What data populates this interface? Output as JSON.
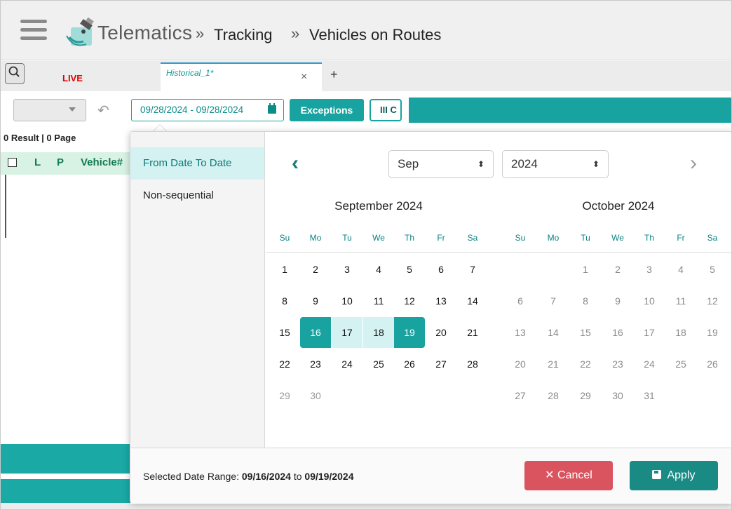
{
  "header": {
    "brand": "Telematics",
    "crumbs": [
      "Tracking",
      "Vehicles on Routes"
    ],
    "separator": "»"
  },
  "tabs": {
    "live": "LIVE",
    "historical": "Historical_1*",
    "close": "×",
    "add": "+"
  },
  "toolbar": {
    "date_range": "09/28/2024 - 09/28/2024",
    "exceptions": "Exceptions",
    "columns": "III C",
    "undo": "↶"
  },
  "results": "0 Result | 0 Page",
  "grid": {
    "cols": [
      "L",
      "P",
      "Vehicle#"
    ]
  },
  "picker": {
    "options": [
      "From Date To Date",
      "Non-sequential"
    ],
    "month_select": "Sep",
    "year_select": "2024",
    "prev": "‹",
    "next": "›",
    "updown": "⬍",
    "left_title": "September 2024",
    "right_title": "October 2024",
    "weekdays": [
      "Su",
      "Mo",
      "Tu",
      "We",
      "Th",
      "Fr",
      "Sa"
    ],
    "footer_label": "Selected Date Range:",
    "range_from": "09/16/2024",
    "range_to": "09/19/2024",
    "range_join": "to",
    "cancel": "✕  Cancel",
    "apply": "Apply"
  },
  "colors": {
    "teal": "#18a3a0",
    "cancel": "#d9545e",
    "apply": "#1a8a85",
    "live": "#e00000"
  }
}
